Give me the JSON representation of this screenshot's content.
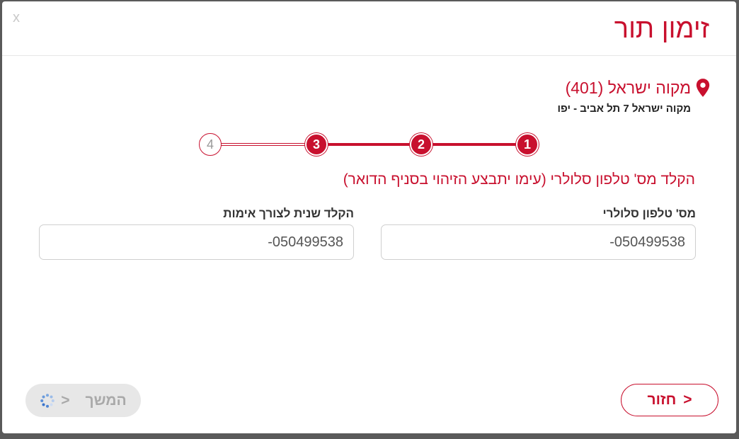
{
  "modal": {
    "close_label": "x",
    "title": "זימון תור"
  },
  "location": {
    "icon": "location-pin-icon",
    "name": "מקוה ישראל (401)",
    "address": "מקוה ישראל 7 תל אביב - יפו"
  },
  "stepper": {
    "steps": [
      "1",
      "2",
      "3",
      "4"
    ],
    "current_step": 3
  },
  "form": {
    "instruction": "הקלד מס' טלפון סלולרי (עימו יתבצע הזיהוי בסניף הדואר)",
    "phone_label": "מס' טלפון סלולרי",
    "phone_value": "-050499538",
    "confirm_label": "הקלד שנית לצורך אימות",
    "confirm_value": "-050499538"
  },
  "actions": {
    "back_arrow": "<",
    "back_label": "חזור",
    "next_label": "המשך",
    "next_arrow": ">",
    "next_state": "loading"
  },
  "colors": {
    "accent": "#c8102e",
    "disabled": "#e7e7e7"
  }
}
